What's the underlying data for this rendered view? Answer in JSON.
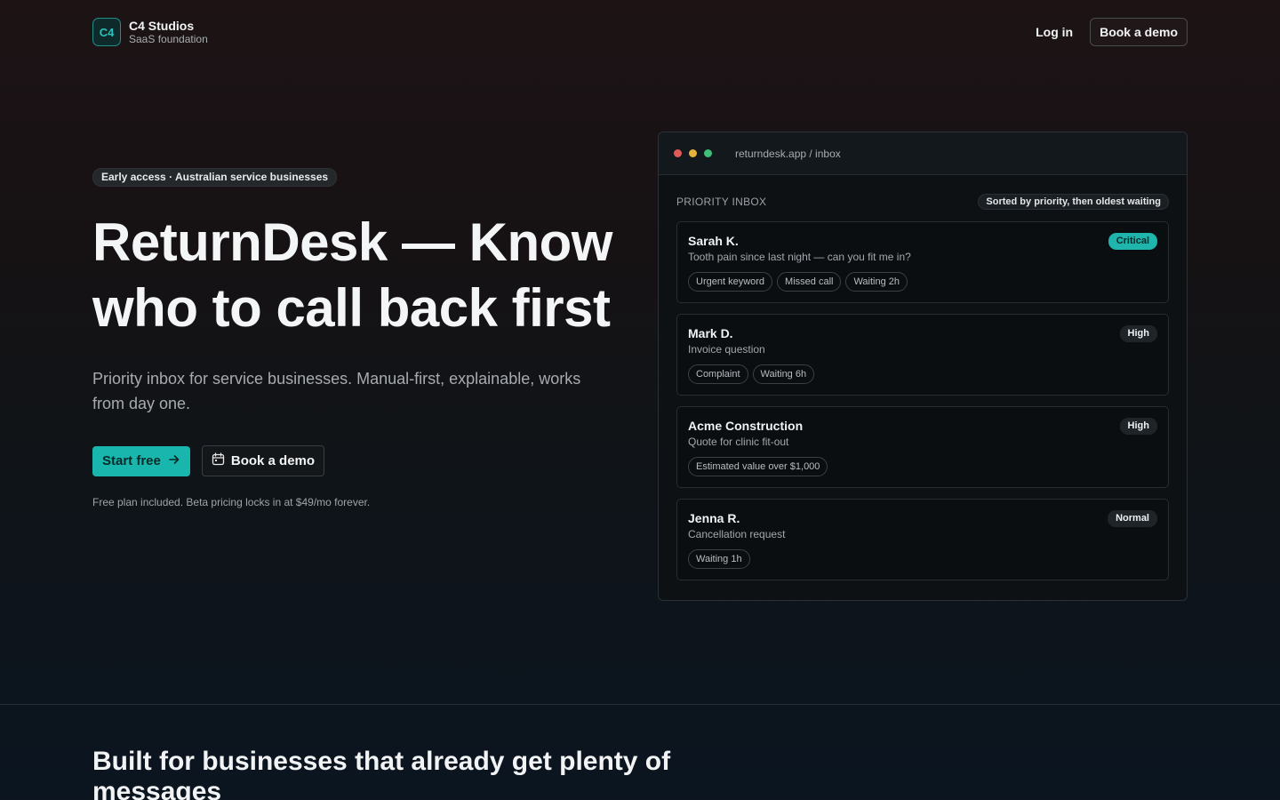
{
  "header": {
    "logo_text": "C4",
    "brand_name": "C4 Studios",
    "brand_sub": "SaaS foundation",
    "login_label": "Log in",
    "demo_label": "Book a demo"
  },
  "hero": {
    "pill": "Early access · Australian service businesses",
    "title": "ReturnDesk — Know who to call back first",
    "lede": "Priority inbox for service businesses. Manual-first, explainable, works from day one.",
    "primary_cta": "Start free",
    "secondary_cta": "Book a demo",
    "fine_print": "Free plan included. Beta pricing locks in at $49/mo forever."
  },
  "mock": {
    "url": "returndesk.app / inbox",
    "inbox_title": "PRIORITY INBOX",
    "sort_label": "Sorted by priority, then oldest waiting",
    "cards": [
      {
        "name": "Sarah K.",
        "message": "Tooth pain since last night — can you fit me in?",
        "priority": "Critical",
        "tags": [
          "Urgent keyword",
          "Missed call",
          "Waiting 2h"
        ]
      },
      {
        "name": "Mark D.",
        "message": "Invoice question",
        "priority": "High",
        "tags": [
          "Complaint",
          "Waiting 6h"
        ]
      },
      {
        "name": "Acme Construction",
        "message": "Quote for clinic fit-out",
        "priority": "High",
        "tags": [
          "Estimated value over $1,000"
        ]
      },
      {
        "name": "Jenna R.",
        "message": "Cancellation request",
        "priority": "Normal",
        "tags": [
          "Waiting 1h"
        ]
      }
    ]
  },
  "section": {
    "title": "Built for businesses that already get plenty of messages"
  },
  "colors": {
    "accent": "#18b6ad",
    "window_dot_red": "#e25b5b",
    "window_dot_yellow": "#e6b23a",
    "window_dot_green": "#3fbf7a"
  }
}
